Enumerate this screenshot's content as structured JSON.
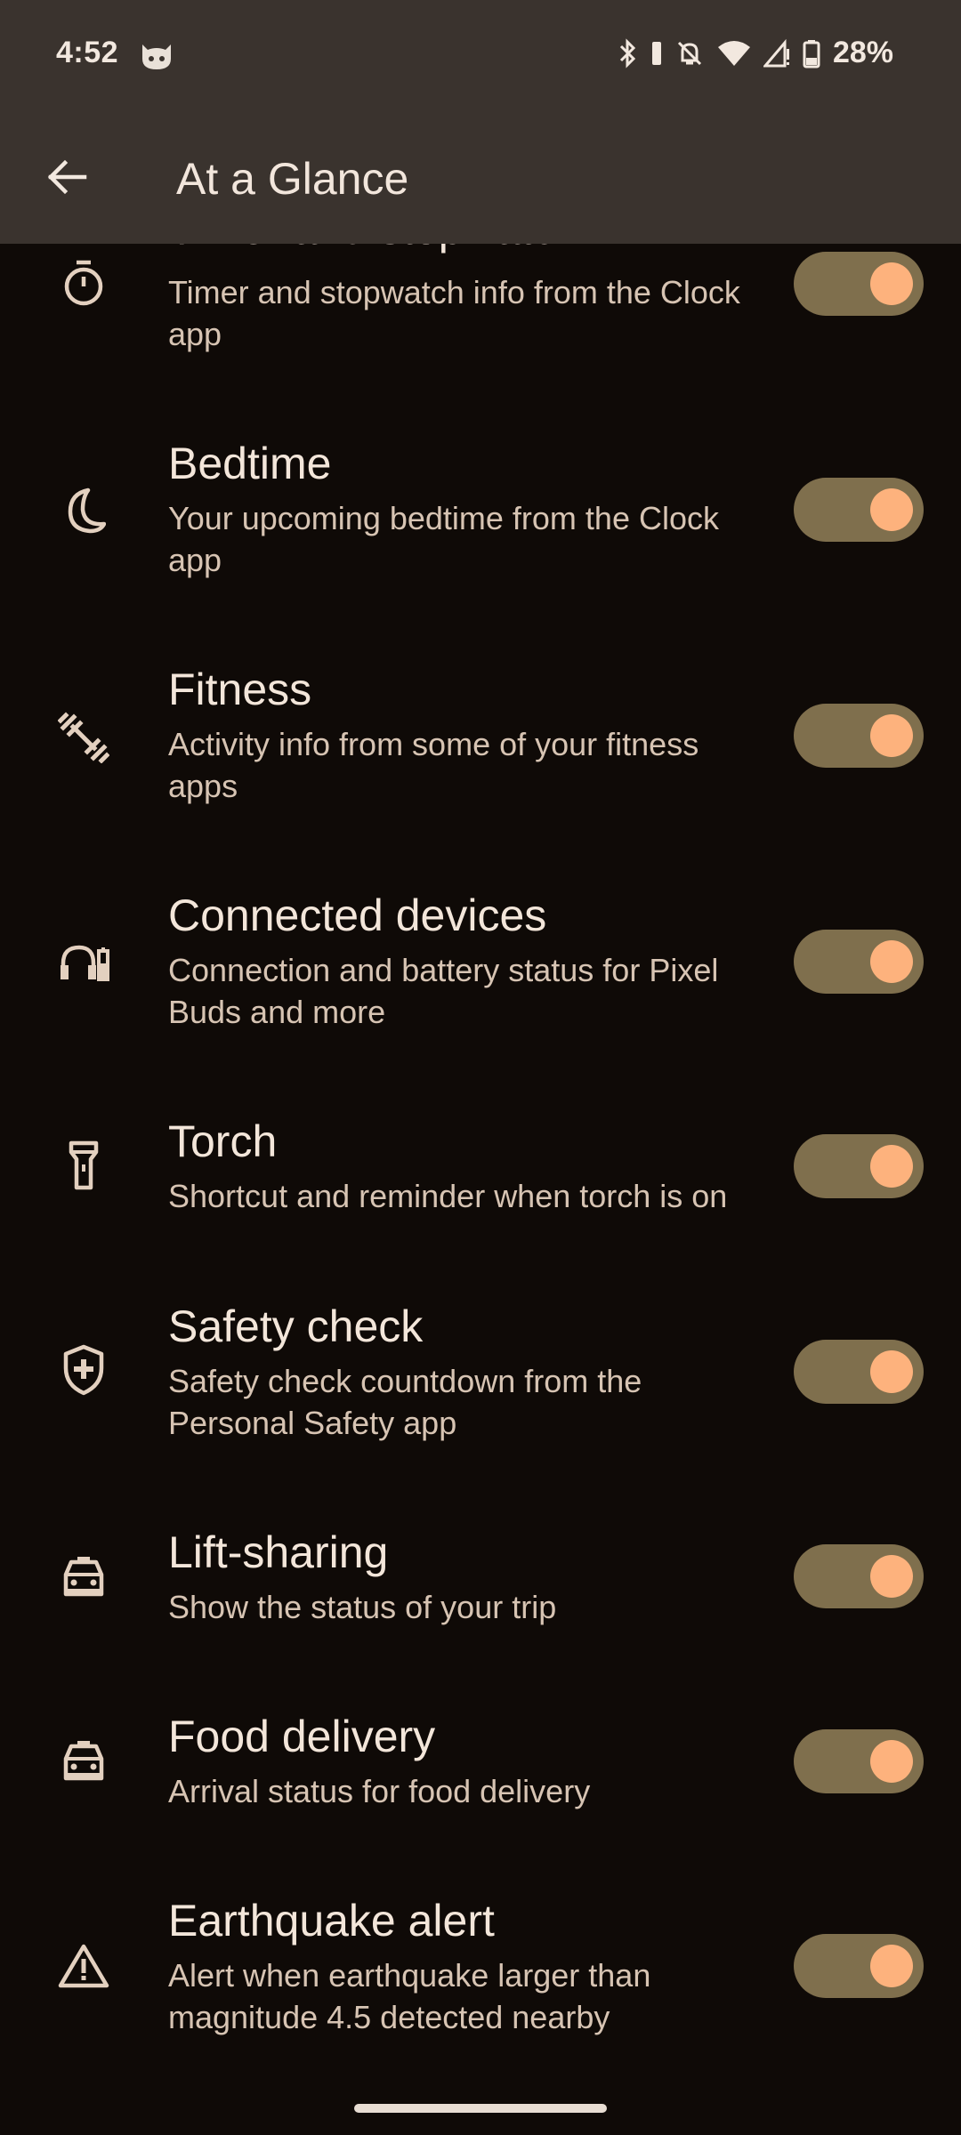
{
  "status_bar": {
    "time": "4:52",
    "battery": "28%"
  },
  "app_bar": {
    "title": "At a Glance"
  },
  "items": [
    {
      "title": "Timer and stopwatch",
      "desc": "Timer and stopwatch info from the Clock app",
      "icon": "timer-icon",
      "enabled": true
    },
    {
      "title": "Bedtime",
      "desc": "Your upcoming bedtime from the Clock app",
      "icon": "moon-icon",
      "enabled": true
    },
    {
      "title": "Fitness",
      "desc": "Activity info from some of your fitness apps",
      "icon": "dumbbell-icon",
      "enabled": true
    },
    {
      "title": "Connected devices",
      "desc": "Connection and battery status for Pixel Buds and more",
      "icon": "headphones-battery-icon",
      "enabled": true
    },
    {
      "title": "Torch",
      "desc": "Shortcut and reminder when torch is on",
      "icon": "torch-icon",
      "enabled": true
    },
    {
      "title": "Safety check",
      "desc": "Safety check countdown from the Personal Safety app",
      "icon": "shield-plus-icon",
      "enabled": true
    },
    {
      "title": "Lift-sharing",
      "desc": "Show the status of your trip",
      "icon": "car-icon",
      "enabled": true
    },
    {
      "title": "Food delivery",
      "desc": "Arrival status for food delivery",
      "icon": "car-icon",
      "enabled": true
    },
    {
      "title": "Earthquake alert",
      "desc": "Alert when earthquake larger than magnitude 4.5 detected nearby",
      "icon": "warning-icon",
      "enabled": true
    }
  ],
  "colors": {
    "background": "#0f0a07",
    "app_bar": "#3a332e",
    "toggle_track": "#7f6f4d",
    "toggle_knob": "#fdb27d"
  }
}
